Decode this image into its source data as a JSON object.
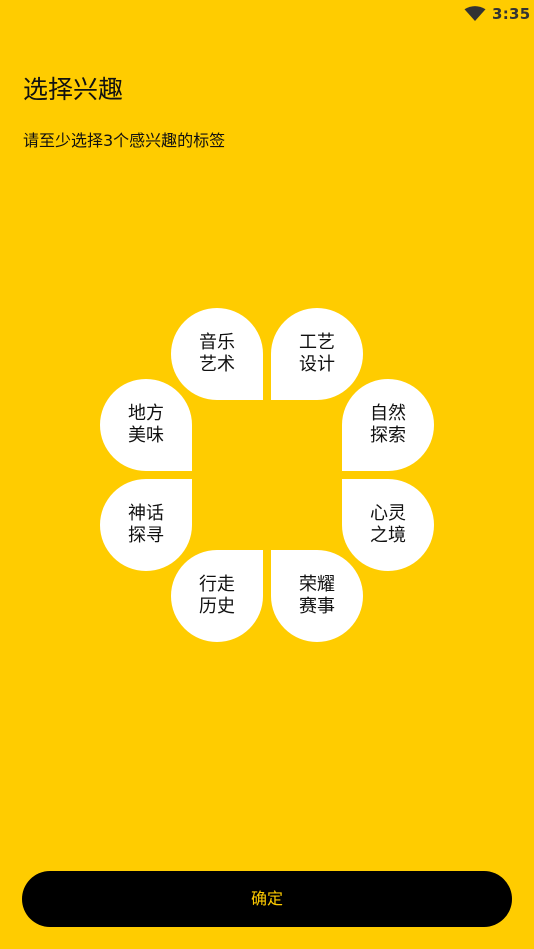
{
  "status_bar": {
    "time": "3:35",
    "wifi_icon": "wifi-icon"
  },
  "header": {
    "title": "选择兴趣",
    "subtitle": "请至少选择3个感兴趣的标签"
  },
  "tags": [
    {
      "line1": "音乐",
      "line2": "艺术"
    },
    {
      "line1": "工艺",
      "line2": "设计"
    },
    {
      "line1": "自然",
      "line2": "探索"
    },
    {
      "line1": "心灵",
      "line2": "之境"
    },
    {
      "line1": "荣耀",
      "line2": "赛事"
    },
    {
      "line1": "行走",
      "line2": "历史"
    },
    {
      "line1": "神话",
      "line2": "探寻"
    },
    {
      "line1": "地方",
      "line2": "美味"
    }
  ],
  "footer": {
    "confirm_label": "确定"
  },
  "colors": {
    "background": "#FFCC00",
    "petal": "#FFFFFF",
    "button": "#000000",
    "button_text": "#FFCC00"
  }
}
